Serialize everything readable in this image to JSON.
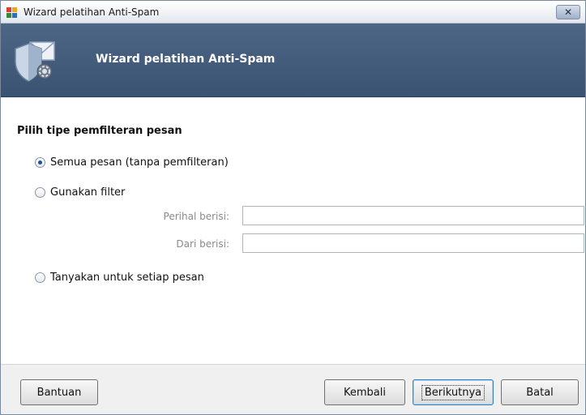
{
  "window": {
    "title": "Wizard pelatihan Anti-Spam",
    "close_glyph": "✕"
  },
  "banner": {
    "title": "Wizard pelatihan Anti-Spam",
    "icon": "shield-envelope-gear-icon"
  },
  "form": {
    "section_title": "Pilih tipe pemfilteran pesan",
    "options": [
      {
        "label": "Semua pesan (tanpa pemfilteran)",
        "checked": true
      },
      {
        "label": "Gunakan filter",
        "checked": false
      },
      {
        "label": "Tanyakan untuk setiap pesan",
        "checked": false
      }
    ],
    "fields": {
      "subject": {
        "label": "Perihal berisi:",
        "value": ""
      },
      "from": {
        "label": "Dari berisi:",
        "value": ""
      }
    }
  },
  "footer": {
    "help": "Bantuan",
    "back": "Kembali",
    "next": "Berikutnya",
    "cancel": "Batal"
  },
  "colors": {
    "banner": "#455f80",
    "radio_selected": "#1f4e9a",
    "disabled_text": "#8a8a8a"
  }
}
